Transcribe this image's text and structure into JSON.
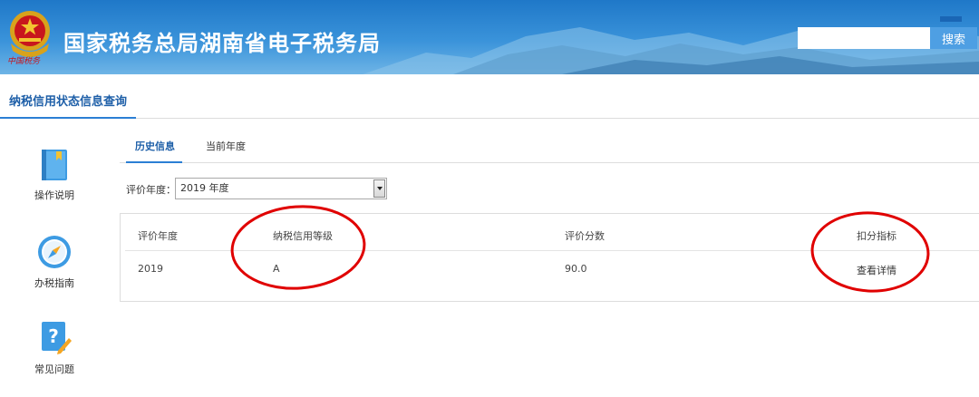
{
  "header": {
    "emblem_text": "中国税务",
    "site_title": "国家税务总局湖南省电子税务局",
    "search": {
      "placeholder": "",
      "button_label": "搜索"
    }
  },
  "page": {
    "title": "纳税信用状态信息查询"
  },
  "sidebar": {
    "items": [
      {
        "label": "操作说明",
        "icon": "book-icon"
      },
      {
        "label": "办税指南",
        "icon": "compass-icon"
      },
      {
        "label": "常见问题",
        "icon": "question-icon"
      }
    ]
  },
  "tabs": [
    {
      "label": "历史信息",
      "active": true
    },
    {
      "label": "当前年度",
      "active": false
    }
  ],
  "year_filter": {
    "label": "评价年度：",
    "selected": "2019 年度"
  },
  "table": {
    "headers": [
      "评价年度",
      "纳税信用等级",
      "评价分数",
      "扣分指标"
    ],
    "rows": [
      {
        "year": "2019",
        "grade": "A",
        "score": "90.0",
        "action": "查看详情"
      }
    ]
  },
  "colors": {
    "accent": "#2b7fd4",
    "annotation": "#e00000",
    "header_blue": "#1f78c8"
  }
}
